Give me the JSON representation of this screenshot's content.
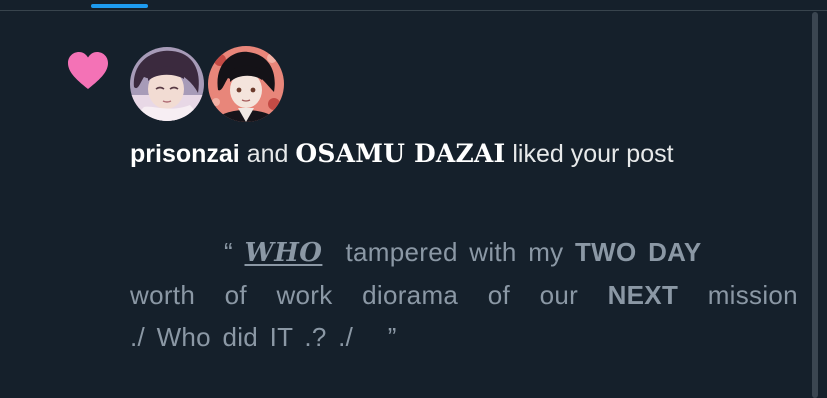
{
  "notification": {
    "type_icon": "heart-icon",
    "type_icon_color": "#f91880",
    "avatars": [
      {
        "user": "prisonzai"
      },
      {
        "user": "OSAMU DAZAI"
      }
    ],
    "headline": {
      "user_a": "prisonzai",
      "connector": "and",
      "user_b": "OSAMU DAZAI",
      "action": "liked your post"
    },
    "post_preview": {
      "open_quote": "“",
      "who": "WHO",
      "part1": "tampered with my",
      "emph1": "TWO DAY",
      "part2_words": [
        "worth",
        "of",
        "work",
        "diorama",
        "of",
        "our"
      ],
      "emph2": "NEXT",
      "part3": "mission",
      "part4": "./ Who did IT .? ./",
      "close_quote": "”"
    }
  },
  "colors": {
    "background": "#15202b",
    "tab_indicator": "#1d9bf0",
    "primary_text": "#e7e9ea",
    "secondary_text": "#8b98a5",
    "divider": "#38444d"
  }
}
